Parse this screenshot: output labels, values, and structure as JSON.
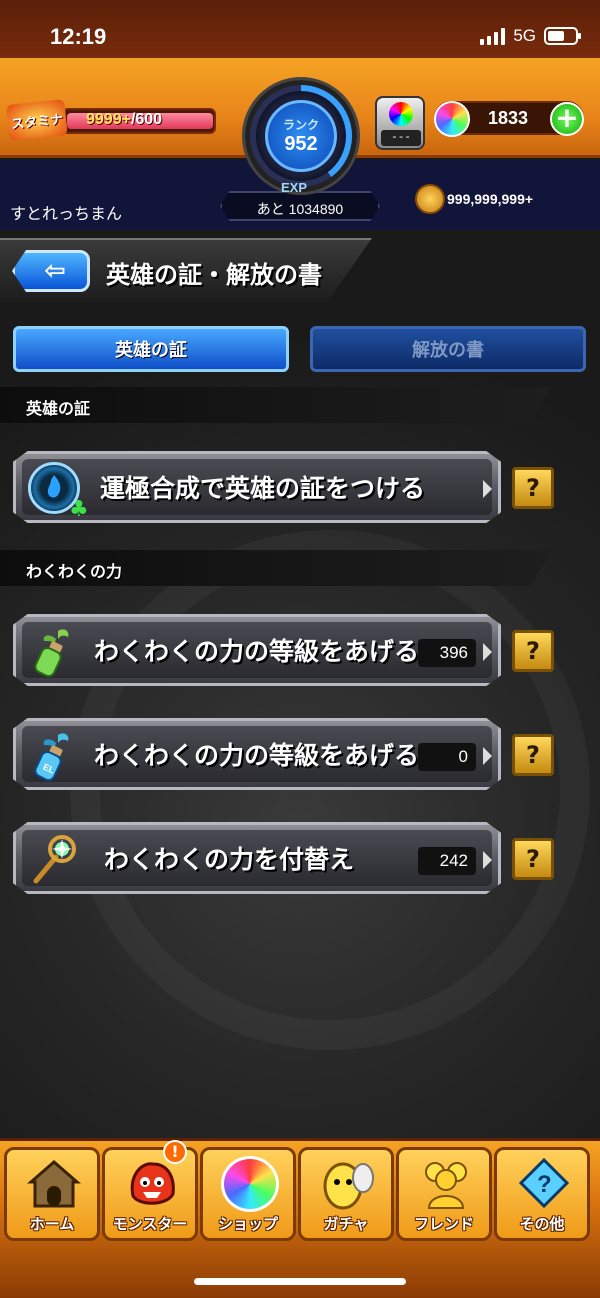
{
  "status_bar": {
    "time": "12:19",
    "network": "5G"
  },
  "header": {
    "stamina_label": "スタミナ",
    "stamina_current": "9999+",
    "stamina_max": "/600",
    "rank_label": "ランク",
    "rank_value": "952",
    "item_box_value": "---",
    "orb_count": "1833",
    "plus_label": "+",
    "player_name": "すとれっちまん",
    "exp_label": "EXP",
    "exp_remaining": "あと 1034890",
    "gold": "999,999,999+"
  },
  "page": {
    "back_arrow": "⇦",
    "title": "英雄の証・解放の書"
  },
  "tabs": [
    {
      "label": "英雄の証",
      "active": true
    },
    {
      "label": "解放の書",
      "active": false
    }
  ],
  "sections": [
    {
      "header": "英雄の証",
      "items": [
        {
          "label": "運極合成で英雄の証をつける",
          "count": "",
          "icon": "hero-fire-clover-icon",
          "help": "?"
        }
      ]
    },
    {
      "header": "わくわくの力",
      "items": [
        {
          "label": "わくわくの力の等級をあげる",
          "count": "396",
          "icon": "green-sprout-bottle-icon",
          "help": "?"
        },
        {
          "label": "わくわくの力の等級をあげる",
          "count": "0",
          "icon": "blue-el-bottle-icon",
          "help": "?"
        },
        {
          "label": "わくわくの力を付替え",
          "count": "242",
          "icon": "crystal-wand-icon",
          "help": "?"
        }
      ]
    }
  ],
  "bottom_nav": [
    {
      "label": "ホーム",
      "icon": "house-icon"
    },
    {
      "label": "モンスター",
      "icon": "red-monster-icon",
      "alert": "!"
    },
    {
      "label": "ショップ",
      "icon": "rainbow-orb-icon"
    },
    {
      "label": "ガチャ",
      "icon": "gacha-egg-icon"
    },
    {
      "label": "フレンド",
      "icon": "friends-icon"
    },
    {
      "label": "その他",
      "icon": "diamond-question-icon"
    }
  ],
  "colors": {
    "header_orange": "#f5a324",
    "tab_active_blue": "#1f6fe0",
    "help_gold": "#ffd75a"
  }
}
